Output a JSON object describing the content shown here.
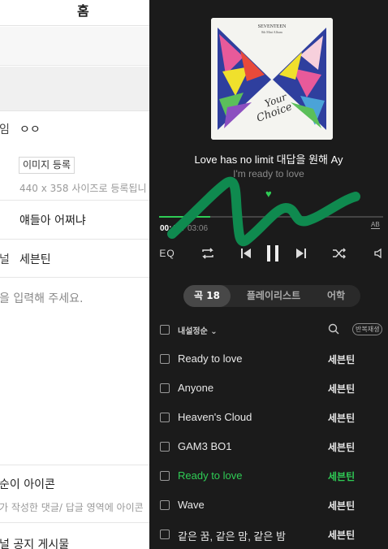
{
  "left_page": {
    "header_title": "홈",
    "name_label_fragment": "임",
    "name_value": "ㅇㅇ",
    "image_register_button": "이미지 등록",
    "image_size_hint": "440 x 358 사이즈로 등록됩니",
    "intro_value": "얘들아 어쩌냐",
    "nickname_label_fragment": "널",
    "nickname_value": "세븐틴",
    "input_placeholder": "을 입력해 주세요.",
    "icon_section_title": "순이 아이콘",
    "icon_section_desc": "가 작성한 댓글/ 답글 영역에 아이콘",
    "notice_title": "널 공지 게시물"
  },
  "player": {
    "song_title": "Love has no limit 대답을 원해 Ay",
    "lyric_next": "I'm ready to love",
    "progress": 0.23,
    "time_current": "00:47",
    "time_separator": "/",
    "time_total": "03:06",
    "ab_repeat_label": "AB",
    "eq_label": "EQ",
    "tabs": [
      {
        "label": "곡 18",
        "active": true
      },
      {
        "label": "플레이리스트",
        "active": false
      },
      {
        "label": "어학",
        "active": false
      }
    ],
    "sort_label": "내설정순",
    "repeat_play_label": "반복재생",
    "tracks": [
      {
        "title": "Ready to love",
        "artist": "세븐틴",
        "playing": false
      },
      {
        "title": "Anyone",
        "artist": "세븐틴",
        "playing": false
      },
      {
        "title": "Heaven's Cloud",
        "artist": "세븐틴",
        "playing": false
      },
      {
        "title": "GAM3 BO1",
        "artist": "세븐틴",
        "playing": false
      },
      {
        "title": "Ready to love",
        "artist": "세븐틴",
        "playing": true
      },
      {
        "title": "Wave",
        "artist": "세븐틴",
        "playing": false
      },
      {
        "title": "같은 꿈, 같은 맘, 같은 밤",
        "artist": "세븐틴",
        "playing": false
      }
    ],
    "album_cover": {
      "artist_text": "SEVENTEEN",
      "subtitle_text": "8th Mini Album",
      "script_line1": "Your",
      "script_line2": "Choice"
    },
    "colors": {
      "background": "#1b1b1b",
      "accent": "#2fcc55",
      "scribble": "#0f8a4f"
    }
  }
}
